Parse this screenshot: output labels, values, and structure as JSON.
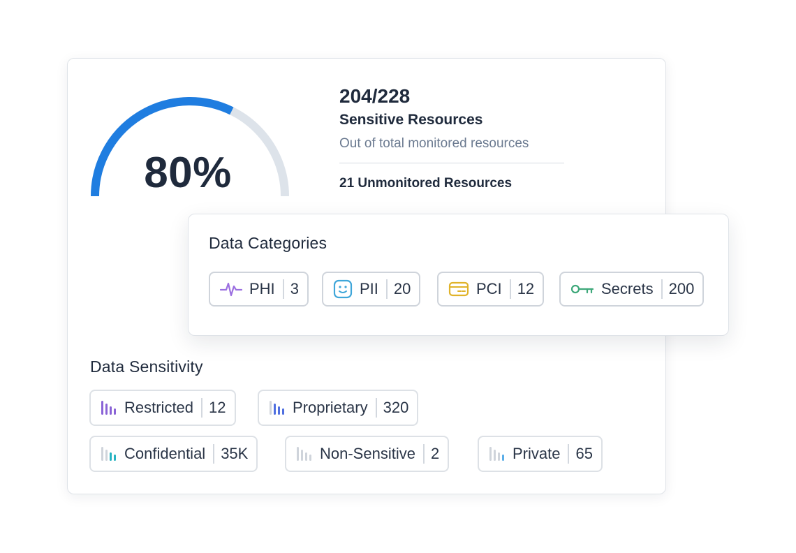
{
  "gauge": {
    "percent_label": "80%",
    "fraction": 0.8,
    "fill_color": "#1f7de0",
    "track_color": "#dde3ea"
  },
  "stats": {
    "count": "204/228",
    "title": "Sensitive Resources",
    "subtitle": "Out of total monitored resources",
    "unmonitored": "21 Unmonitored Resources"
  },
  "categories": {
    "title": "Data Categories",
    "items": [
      {
        "label": "PHI",
        "count": "3",
        "icon": "pulse-icon",
        "color": "#9b6fe0"
      },
      {
        "label": "PII",
        "count": "20",
        "icon": "smiley-face-icon",
        "color": "#3fa6d9"
      },
      {
        "label": "PCI",
        "count": "12",
        "icon": "credit-card-icon",
        "color": "#e0b32a"
      },
      {
        "label": "Secrets",
        "count": "200",
        "icon": "key-icon",
        "color": "#3ea87a"
      }
    ]
  },
  "sensitivity": {
    "title": "Data Sensitivity",
    "items": [
      {
        "label": "Restricted",
        "count": "12",
        "icon": "bars-icon",
        "color": "#8a63d6"
      },
      {
        "label": "Proprietary",
        "count": "320",
        "icon": "bars-icon",
        "color": "#4f6fe0"
      },
      {
        "label": "Confidential",
        "count": "35K",
        "icon": "bars-icon",
        "color": "#27b3c2"
      },
      {
        "label": "Non-Sensitive",
        "count": "2",
        "icon": "bars-icon",
        "color": "#cfd4db"
      },
      {
        "label": "Private",
        "count": "65",
        "icon": "bars-icon",
        "color": "#5aaee8"
      }
    ]
  }
}
